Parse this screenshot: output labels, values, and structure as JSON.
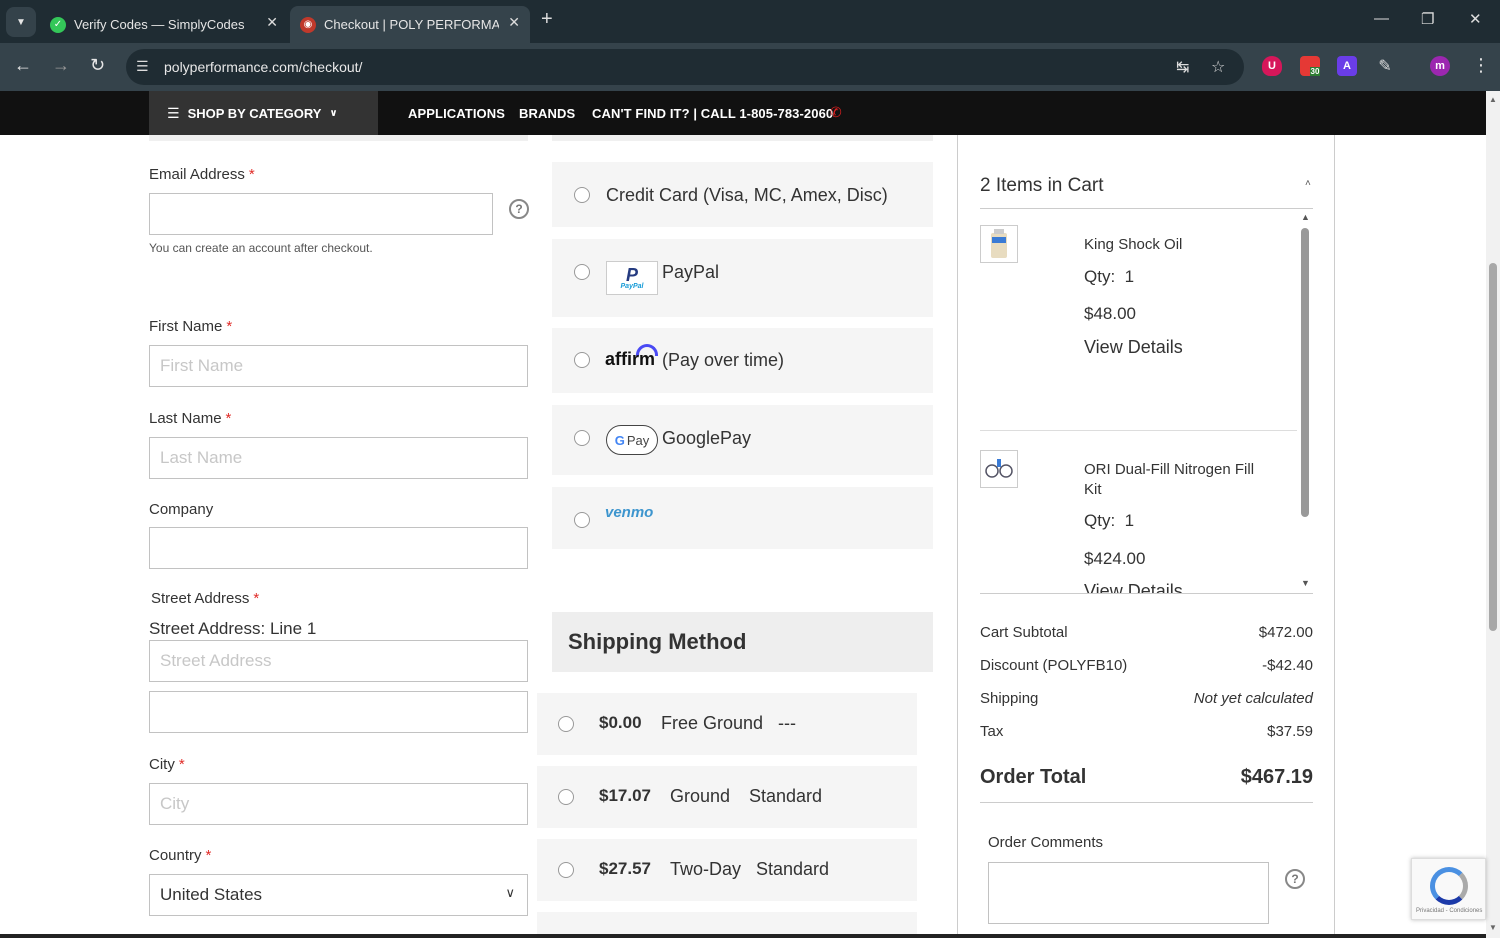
{
  "browser": {
    "tabs": [
      {
        "title": "Verify Codes — SimplyCodes",
        "favicon_color": "#34c759"
      },
      {
        "title": "Checkout | POLY PERFORMANC",
        "favicon_color": "#c0392b"
      }
    ],
    "url": "polyperformance.com/checkout/",
    "extension_badge": "30",
    "profile_initial": "m"
  },
  "sitenav": {
    "shop_by_category": "SHOP BY CATEGORY",
    "applications": "APPLICATIONS",
    "brands": "BRANDS",
    "call": "CAN'T FIND IT? | CALL 1-805-783-2060"
  },
  "form": {
    "email": {
      "label": "Email Address",
      "value": "",
      "hint": "You can create an account after checkout."
    },
    "first_name": {
      "label": "First Name",
      "placeholder": "First Name"
    },
    "last_name": {
      "label": "Last Name",
      "placeholder": "Last Name"
    },
    "company": {
      "label": "Company",
      "value": ""
    },
    "street": {
      "label": "Street Address",
      "sublabel": "Street Address: Line 1",
      "placeholder": "Street Address"
    },
    "city": {
      "label": "City",
      "placeholder": "City"
    },
    "country": {
      "label": "Country",
      "value": "United States"
    },
    "required_mark": "*"
  },
  "payment": {
    "credit_card": "Credit Card (Visa, MC, Amex, Disc)",
    "paypal": "PayPal",
    "paypal_logo_text": "PayPal",
    "affirm_logo": "affirm",
    "affirm": "(Pay over time)",
    "gpay_logo": "Pay",
    "googlepay": "GooglePay",
    "venmo": "venmo"
  },
  "shipping": {
    "heading": "Shipping Method",
    "methods": [
      {
        "price": "$0.00",
        "carrier": "Free Ground",
        "method": "---"
      },
      {
        "price": "$17.07",
        "carrier": "Ground",
        "method": "Standard"
      },
      {
        "price": "$27.57",
        "carrier": "Two-Day",
        "method": "Standard"
      }
    ]
  },
  "cart": {
    "title": "2 Items in Cart",
    "qty_label": "Qty:",
    "details_label": "View Details",
    "items": [
      {
        "name": "King Shock Oil",
        "qty": "1",
        "price": "$48.00"
      },
      {
        "name": "ORI Dual-Fill Nitrogen Fill Kit",
        "qty": "1",
        "price": "$424.00"
      }
    ]
  },
  "summary": {
    "subtotal_label": "Cart Subtotal",
    "subtotal": "$472.00",
    "discount_label": "Discount (POLYFB10)",
    "discount": "-$42.40",
    "shipping_label": "Shipping",
    "shipping": "Not yet calculated",
    "tax_label": "Tax",
    "tax": "$37.59",
    "total_label": "Order Total",
    "total": "$467.19"
  },
  "comments": {
    "label": "Order Comments",
    "value": ""
  },
  "recaptcha": {
    "text": "Privacidad - Condiciones"
  }
}
